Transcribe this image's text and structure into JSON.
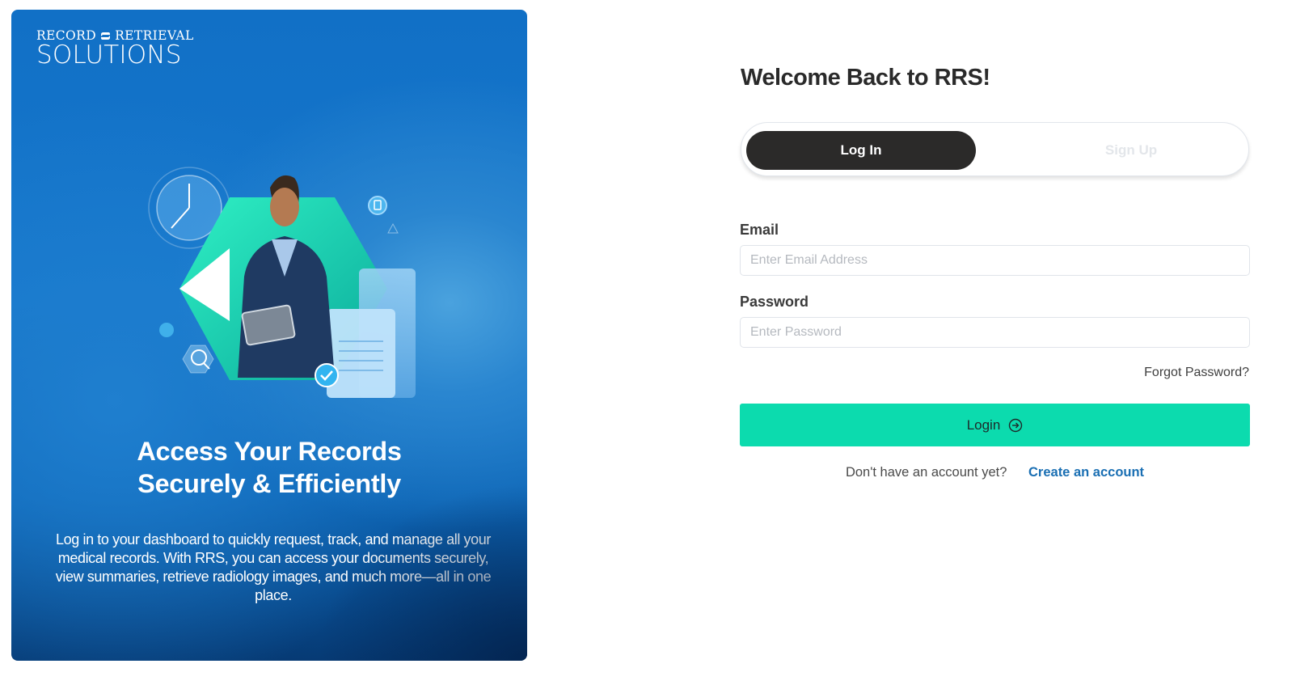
{
  "brand": {
    "logo_top": "RECORD RETRIEVAL",
    "logo_bottom": "SOLUTIONS"
  },
  "hero": {
    "title_line1": "Access Your Records",
    "title_line2": "Securely & Efficiently",
    "description": "Log in to your dashboard to quickly request, track, and manage all your medical records. With RRS, you can access your documents securely, view summaries, retrieve radiology images, and much more—all in one place."
  },
  "form": {
    "heading": "Welcome Back to RRS!",
    "tabs": [
      {
        "label": "Log In",
        "active": true
      },
      {
        "label": "Sign Up",
        "active": false
      }
    ],
    "email": {
      "label": "Email",
      "placeholder": "Enter Email Address",
      "value": ""
    },
    "password": {
      "label": "Password",
      "placeholder": "Enter Password",
      "value": ""
    },
    "forgot_label": "Forgot Password?",
    "login_button": "Login",
    "no_account_text": "Don't have an account yet?",
    "create_account_link": "Create an account"
  },
  "icons": {
    "login_button_icon": "arrow-right-circle-icon",
    "logo_mark": "rrs-logo-mark-icon"
  },
  "colors": {
    "primary_button": "#0cdbae",
    "active_tab": "#2b2a29",
    "link": "#1a6fb3",
    "hero_blue": "#1170c6"
  }
}
